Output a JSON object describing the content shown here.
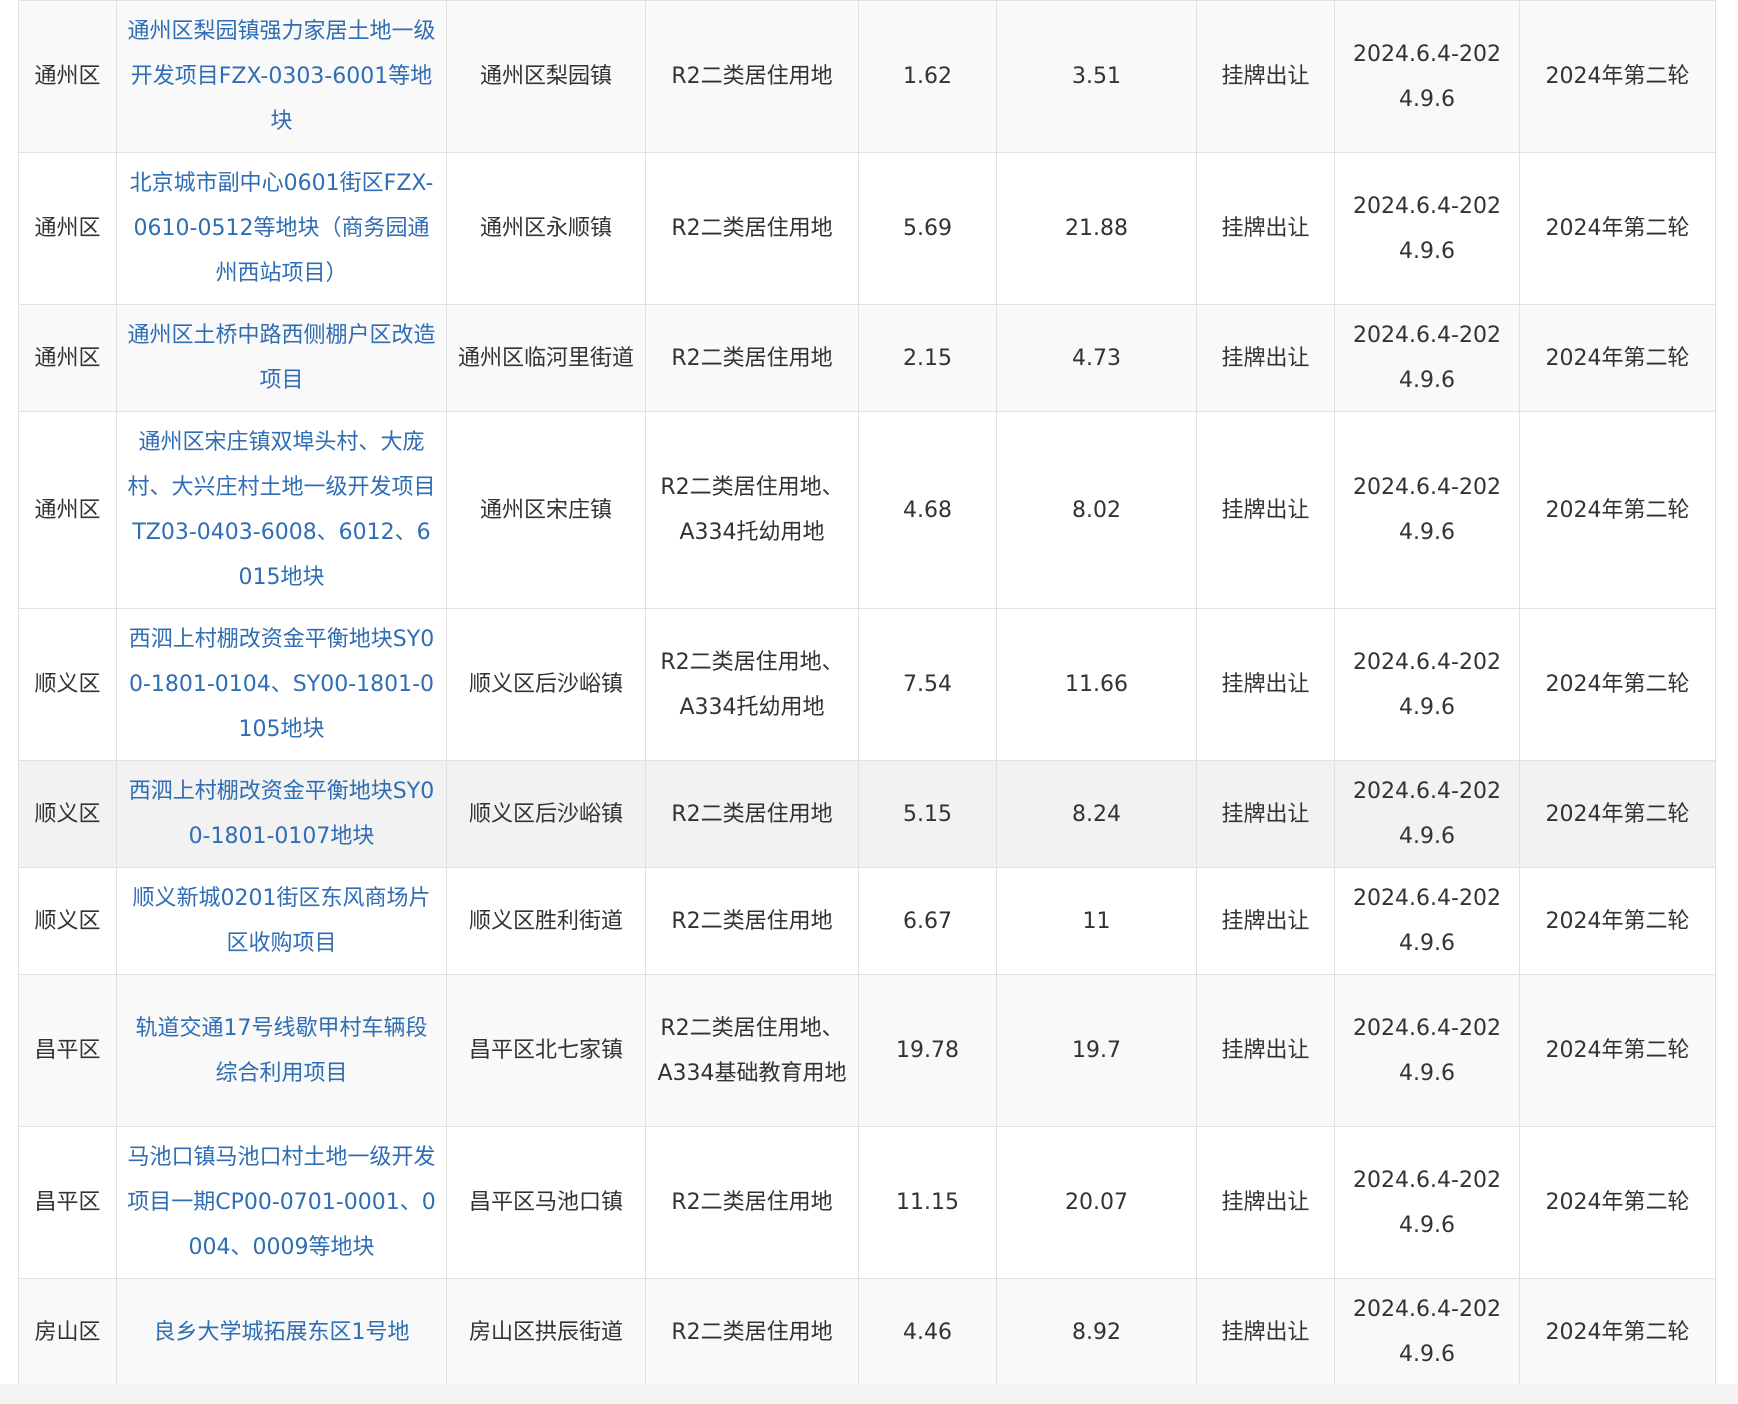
{
  "rows": [
    {
      "district": "通州区",
      "project": "通州区梨园镇强力家居土地一级开发项目FZX-0303-6001等地块",
      "location": "通州区梨园镇",
      "land_use": "R2二类居住用地",
      "area": "1.62",
      "building_area": "3.51",
      "method": "挂牌出让",
      "period": "2024.6.4-2024.9.6",
      "round": "2024年第二轮"
    },
    {
      "district": "通州区",
      "project": "北京城市副中心0601街区FZX-0610-0512等地块（商务园通州西站项目）",
      "location": "通州区永顺镇",
      "land_use": "R2二类居住用地",
      "area": "5.69",
      "building_area": "21.88",
      "method": "挂牌出让",
      "period": "2024.6.4-2024.9.6",
      "round": "2024年第二轮"
    },
    {
      "district": "通州区",
      "project": "通州区土桥中路西侧棚户区改造项目",
      "location": "通州区临河里街道",
      "land_use": "R2二类居住用地",
      "area": "2.15",
      "building_area": "4.73",
      "method": "挂牌出让",
      "period": "2024.6.4-2024.9.6",
      "round": "2024年第二轮"
    },
    {
      "district": "通州区",
      "project": "通州区宋庄镇双埠头村、大庞村、大兴庄村土地一级开发项目TZ03-0403-6008、6012、6015地块",
      "location": "通州区宋庄镇",
      "land_use": "R2二类居住用地、A334托幼用地",
      "area": "4.68",
      "building_area": "8.02",
      "method": "挂牌出让",
      "period": "2024.6.4-2024.9.6",
      "round": "2024年第二轮"
    },
    {
      "district": "顺义区",
      "project": "西泗上村棚改资金平衡地块SY00-1801-0104、SY00-1801-0105地块",
      "location": "顺义区后沙峪镇",
      "land_use": "R2二类居住用地、A334托幼用地",
      "area": "7.54",
      "building_area": "11.66",
      "method": "挂牌出让",
      "period": "2024.6.4-2024.9.6",
      "round": "2024年第二轮"
    },
    {
      "district": "顺义区",
      "project": "西泗上村棚改资金平衡地块SY00-1801-0107地块",
      "location": "顺义区后沙峪镇",
      "land_use": "R2二类居住用地",
      "area": "5.15",
      "building_area": "8.24",
      "method": "挂牌出让",
      "period": "2024.6.4-2024.9.6",
      "round": "2024年第二轮"
    },
    {
      "district": "顺义区",
      "project": "顺义新城0201街区东风商场片区收购项目",
      "location": "顺义区胜利街道",
      "land_use": "R2二类居住用地",
      "area": "6.67",
      "building_area": "11",
      "method": "挂牌出让",
      "period": "2024.6.4-2024.9.6",
      "round": "2024年第二轮"
    },
    {
      "district": "昌平区",
      "project": "轨道交通17号线歇甲村车辆段综合利用项目",
      "location": "昌平区北七家镇",
      "land_use": "R2二类居住用地、A334基础教育用地",
      "area": "19.78",
      "building_area": "19.7",
      "method": "挂牌出让",
      "period": "2024.6.4-2024.9.6",
      "round": "2024年第二轮"
    },
    {
      "district": "昌平区",
      "project": "马池口镇马池口村土地一级开发项目一期CP00-0701-0001、0004、0009等地块",
      "location": "昌平区马池口镇",
      "land_use": "R2二类居住用地",
      "area": "11.15",
      "building_area": "20.07",
      "method": "挂牌出让",
      "period": "2024.6.4-2024.9.6",
      "round": "2024年第二轮"
    },
    {
      "district": "房山区",
      "project": "良乡大学城拓展东区1号地",
      "location": "房山区拱辰街道",
      "land_use": "R2二类居住用地",
      "area": "4.46",
      "building_area": "8.92",
      "method": "挂牌出让",
      "period": "2024.6.4-2024.9.6",
      "round": "2024年第二轮"
    }
  ]
}
